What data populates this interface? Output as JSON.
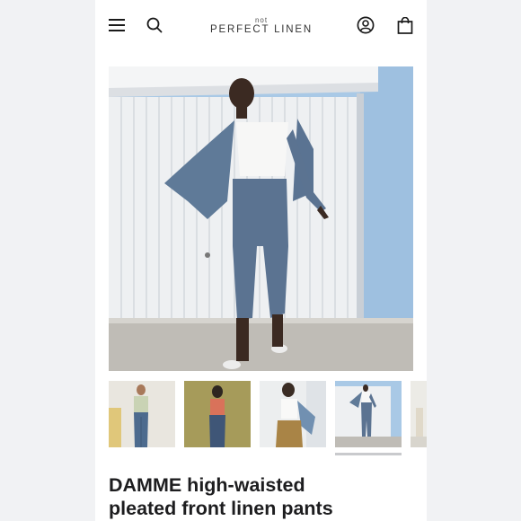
{
  "brand": {
    "small": "not",
    "main": "PERFECT LINEN"
  },
  "header": {
    "menu_icon": "hamburger-menu-icon",
    "search_icon": "search-icon",
    "account_icon": "account-icon",
    "cart_icon": "shopping-bag-icon"
  },
  "gallery": {
    "selected_index": 3,
    "thumbnail_count": 5
  },
  "product": {
    "title_line1": "DAMME high-waisted",
    "title_line2": "pleated front linen pants"
  },
  "colors": {
    "background": "#f1f2f4",
    "card": "#ffffff",
    "text": "#1d1d1f",
    "wall_blue": "#a9c9e6",
    "garage_door": "#f2f3f4",
    "linen_blue": "#5b7391"
  }
}
